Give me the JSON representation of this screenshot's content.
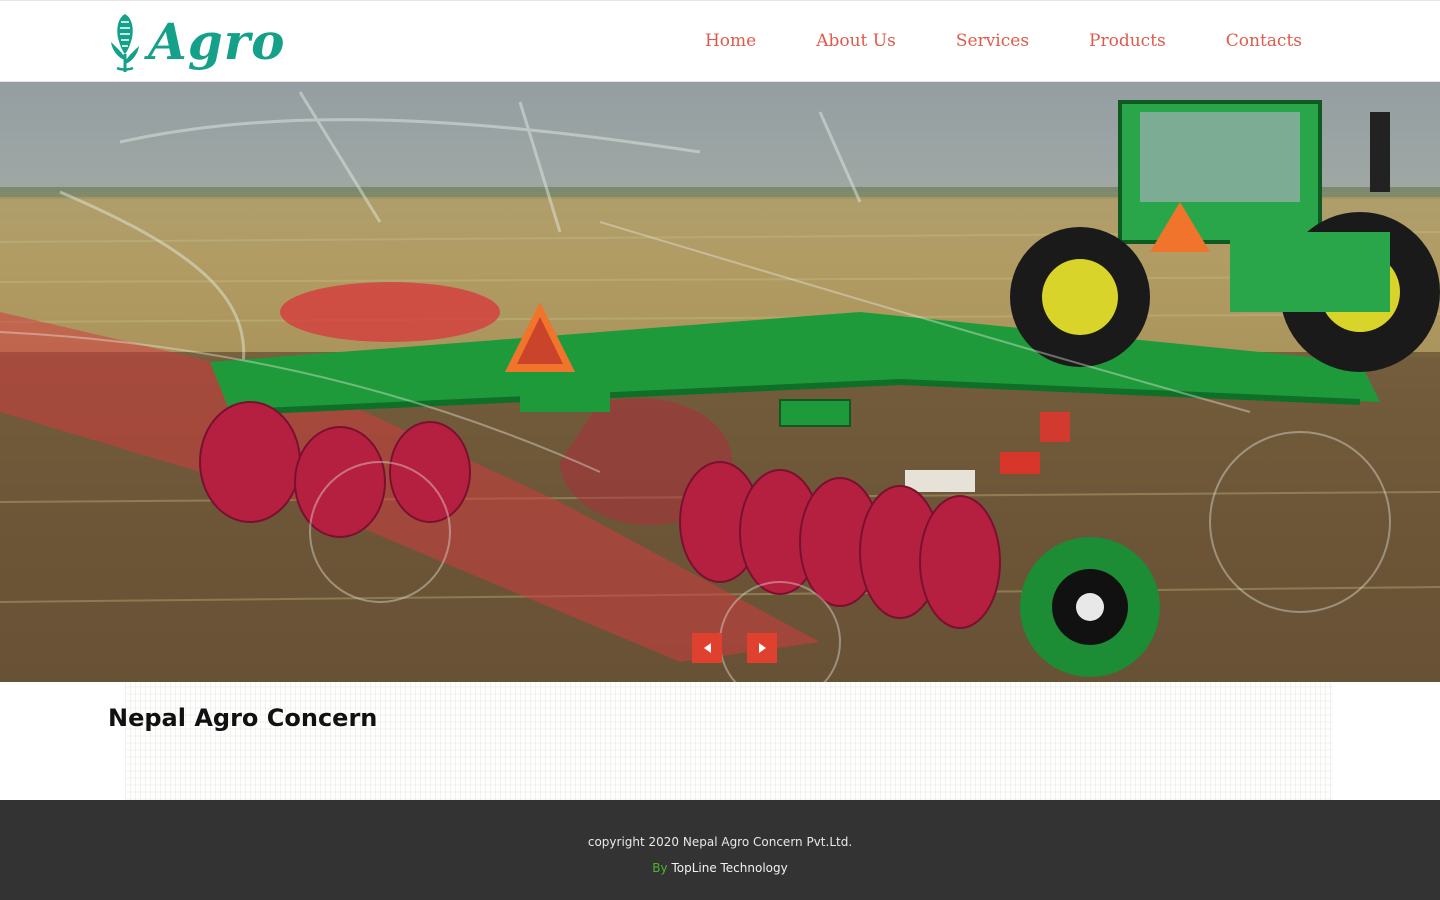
{
  "brand": {
    "logo_text": "Agro",
    "logo_color": "#15a08a"
  },
  "nav": {
    "items": [
      {
        "label": "Home"
      },
      {
        "label": "About Us"
      },
      {
        "label": "Services"
      },
      {
        "label": "Products"
      },
      {
        "label": "Contacts"
      }
    ],
    "color": "#e05a4a"
  },
  "hero": {
    "slider_controls": {
      "prev_icon": "triangle-left-icon",
      "next_icon": "triangle-right-icon",
      "button_color": "#e0412f"
    }
  },
  "main": {
    "title": "Nepal Agro Concern"
  },
  "footer": {
    "copyright": "copyright 2020 Nepal Agro Concern Pvt.Ltd.",
    "by_label": "By",
    "credit_link": "TopLine Technology",
    "background": "#333333"
  }
}
